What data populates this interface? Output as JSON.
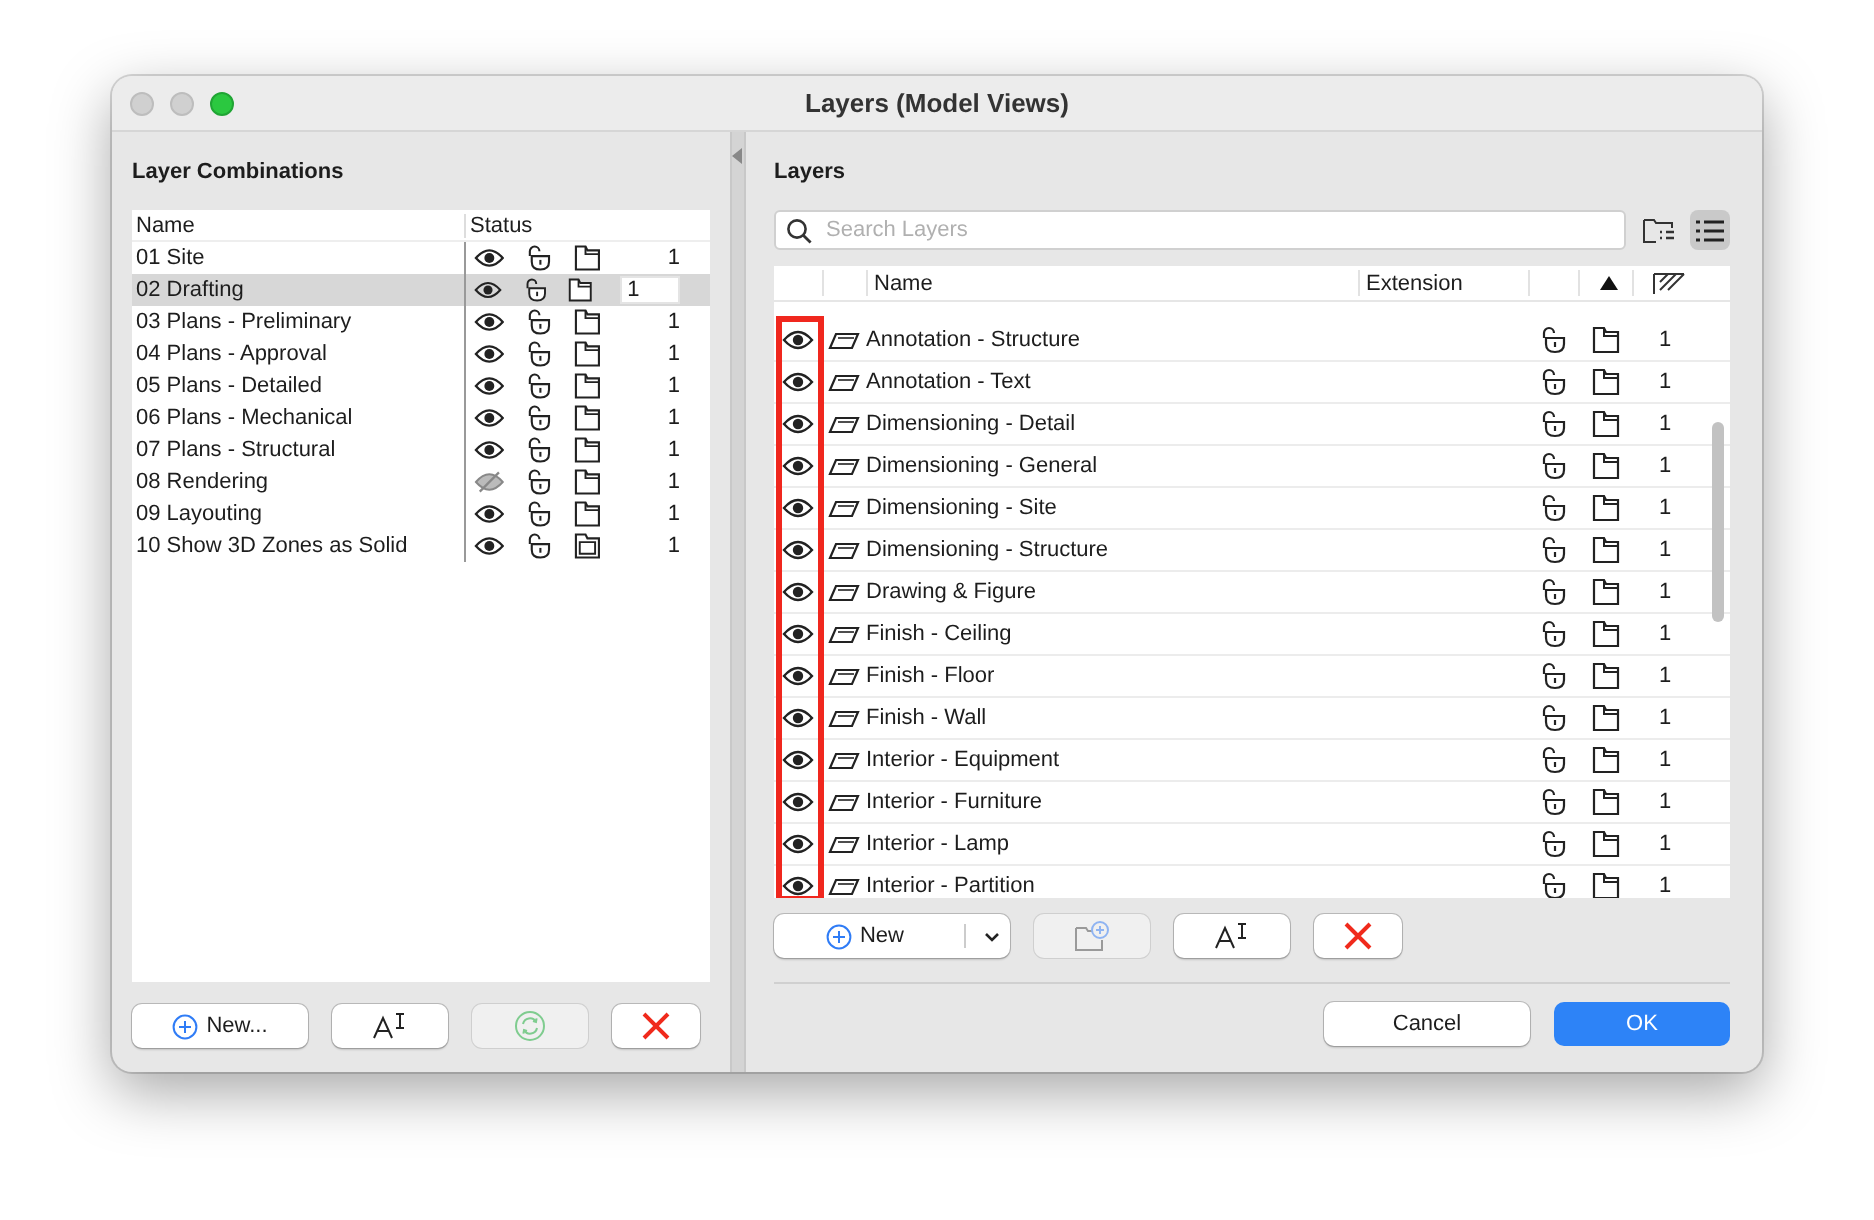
{
  "window": {
    "title": "Layers (Model Views)"
  },
  "combinations": {
    "title": "Layer Combinations",
    "columns": [
      "Name",
      "Status"
    ],
    "rows": [
      {
        "name": "01 Site",
        "visible": true,
        "selected": false,
        "kind": "single",
        "value": "1"
      },
      {
        "name": "02 Drafting",
        "visible": true,
        "selected": true,
        "kind": "single",
        "value": "1"
      },
      {
        "name": "03 Plans - Preliminary",
        "visible": true,
        "selected": false,
        "kind": "single",
        "value": "1"
      },
      {
        "name": "04 Plans - Approval",
        "visible": true,
        "selected": false,
        "kind": "single",
        "value": "1"
      },
      {
        "name": "05 Plans - Detailed",
        "visible": true,
        "selected": false,
        "kind": "single",
        "value": "1"
      },
      {
        "name": "06 Plans - Mechanical",
        "visible": true,
        "selected": false,
        "kind": "single",
        "value": "1"
      },
      {
        "name": "07 Plans - Structural",
        "visible": true,
        "selected": false,
        "kind": "single",
        "value": "1"
      },
      {
        "name": "08 Rendering",
        "visible": false,
        "selected": false,
        "kind": "single",
        "value": "1"
      },
      {
        "name": "09 Layouting",
        "visible": true,
        "selected": false,
        "kind": "single",
        "value": "1"
      },
      {
        "name": "10 Show 3D Zones as Solid",
        "visible": true,
        "selected": false,
        "kind": "stacked",
        "value": "1"
      }
    ],
    "buttons": [
      {
        "kind": "new",
        "label": "New...",
        "disabled": false
      },
      {
        "kind": "rename",
        "disabled": false
      },
      {
        "kind": "update",
        "disabled": true
      },
      {
        "kind": "delete",
        "disabled": false
      }
    ]
  },
  "layers": {
    "title": "Layers",
    "search": {
      "placeholder": "Search Layers"
    },
    "columns": [
      "Name",
      "Extension"
    ],
    "rows": [
      {
        "name": "Annotation - Structure",
        "visible": true,
        "value": "1"
      },
      {
        "name": "Annotation - Text",
        "visible": true,
        "value": "1"
      },
      {
        "name": "Dimensioning - Detail",
        "visible": true,
        "value": "1"
      },
      {
        "name": "Dimensioning - General",
        "visible": true,
        "value": "1"
      },
      {
        "name": "Dimensioning - Site",
        "visible": true,
        "value": "1"
      },
      {
        "name": "Dimensioning - Structure",
        "visible": true,
        "value": "1"
      },
      {
        "name": "Drawing & Figure",
        "visible": true,
        "value": "1"
      },
      {
        "name": "Finish - Ceiling",
        "visible": true,
        "value": "1"
      },
      {
        "name": "Finish - Floor",
        "visible": true,
        "value": "1"
      },
      {
        "name": "Finish - Wall",
        "visible": true,
        "value": "1"
      },
      {
        "name": "Interior - Equipment",
        "visible": true,
        "value": "1"
      },
      {
        "name": "Interior - Furniture",
        "visible": true,
        "value": "1"
      },
      {
        "name": "Interior - Lamp",
        "visible": true,
        "value": "1"
      },
      {
        "name": "Interior - Partition",
        "visible": true,
        "value": "1"
      }
    ],
    "buttons": [
      {
        "kind": "new",
        "label": "New",
        "disabled": false
      },
      {
        "kind": "new-folder",
        "disabled": true
      },
      {
        "kind": "rename",
        "disabled": false
      },
      {
        "kind": "delete",
        "disabled": false
      }
    ]
  },
  "footer": [
    {
      "kind": "default",
      "label": "Cancel"
    },
    {
      "kind": "primary",
      "label": "OK"
    }
  ]
}
